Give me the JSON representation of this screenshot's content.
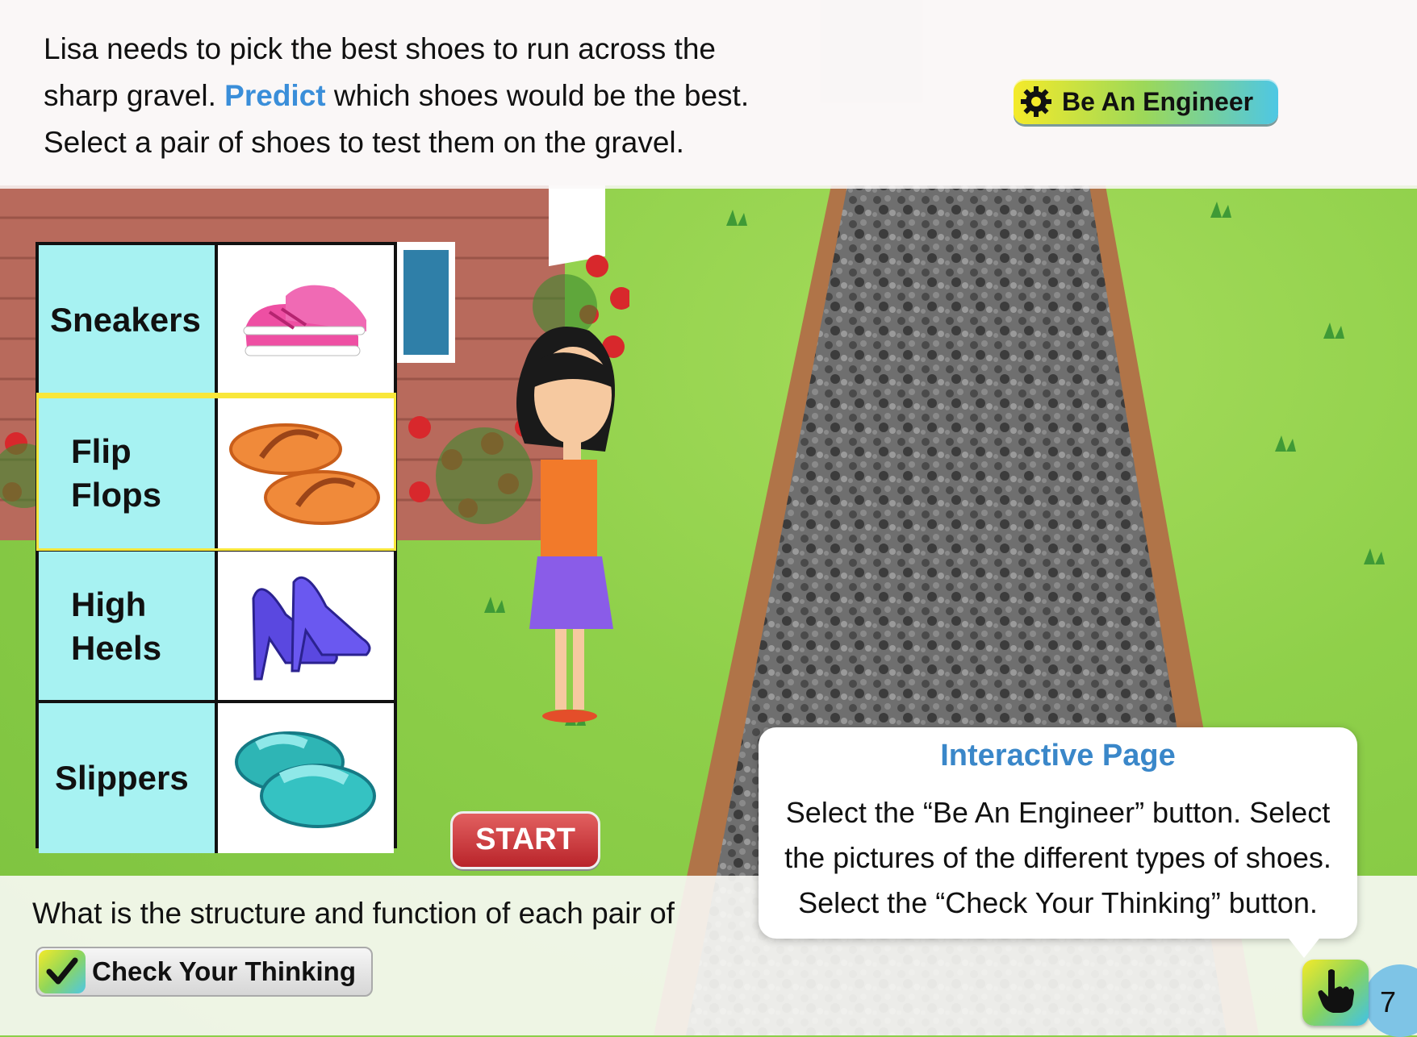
{
  "prompt": {
    "line1": "Lisa needs to pick the best shoes to run across the",
    "line2_pre": "sharp gravel.",
    "line2_highlight": "Predict",
    "line2_post": "which shoes would be the best.",
    "line3": "Select a pair of shoes to test them on the gravel."
  },
  "engineer_button": {
    "label": "Be An Engineer",
    "icon": "gear-icon"
  },
  "shoes": [
    {
      "name": "Sneakers",
      "icon": "sneakers-icon",
      "color": "#ee4fa3"
    },
    {
      "name": "Flip Flops",
      "icon": "flip-flops-icon",
      "color": "#f08a3a",
      "selected": true
    },
    {
      "name": "High Heels",
      "icon": "high-heels-icon",
      "color": "#5a48e0"
    },
    {
      "name": "Slippers",
      "icon": "slippers-icon",
      "color": "#2eb5b5"
    }
  ],
  "start_button": {
    "label": "START"
  },
  "question": "What is the structure and function of each pair of",
  "check_button": {
    "label": "Check Your Thinking",
    "icon": "checkmark-icon"
  },
  "tip": {
    "title": "Interactive Page",
    "body": "Select the “Be An Engineer” button. Select the pictures of the different types of shoes. Select the “Check Your Thinking” button."
  },
  "page_number": "7",
  "colors": {
    "accent": "#3a8ed9",
    "selection": "#f9e73a",
    "table_label_bg": "#a7f2f2",
    "start": "#c8323a"
  }
}
